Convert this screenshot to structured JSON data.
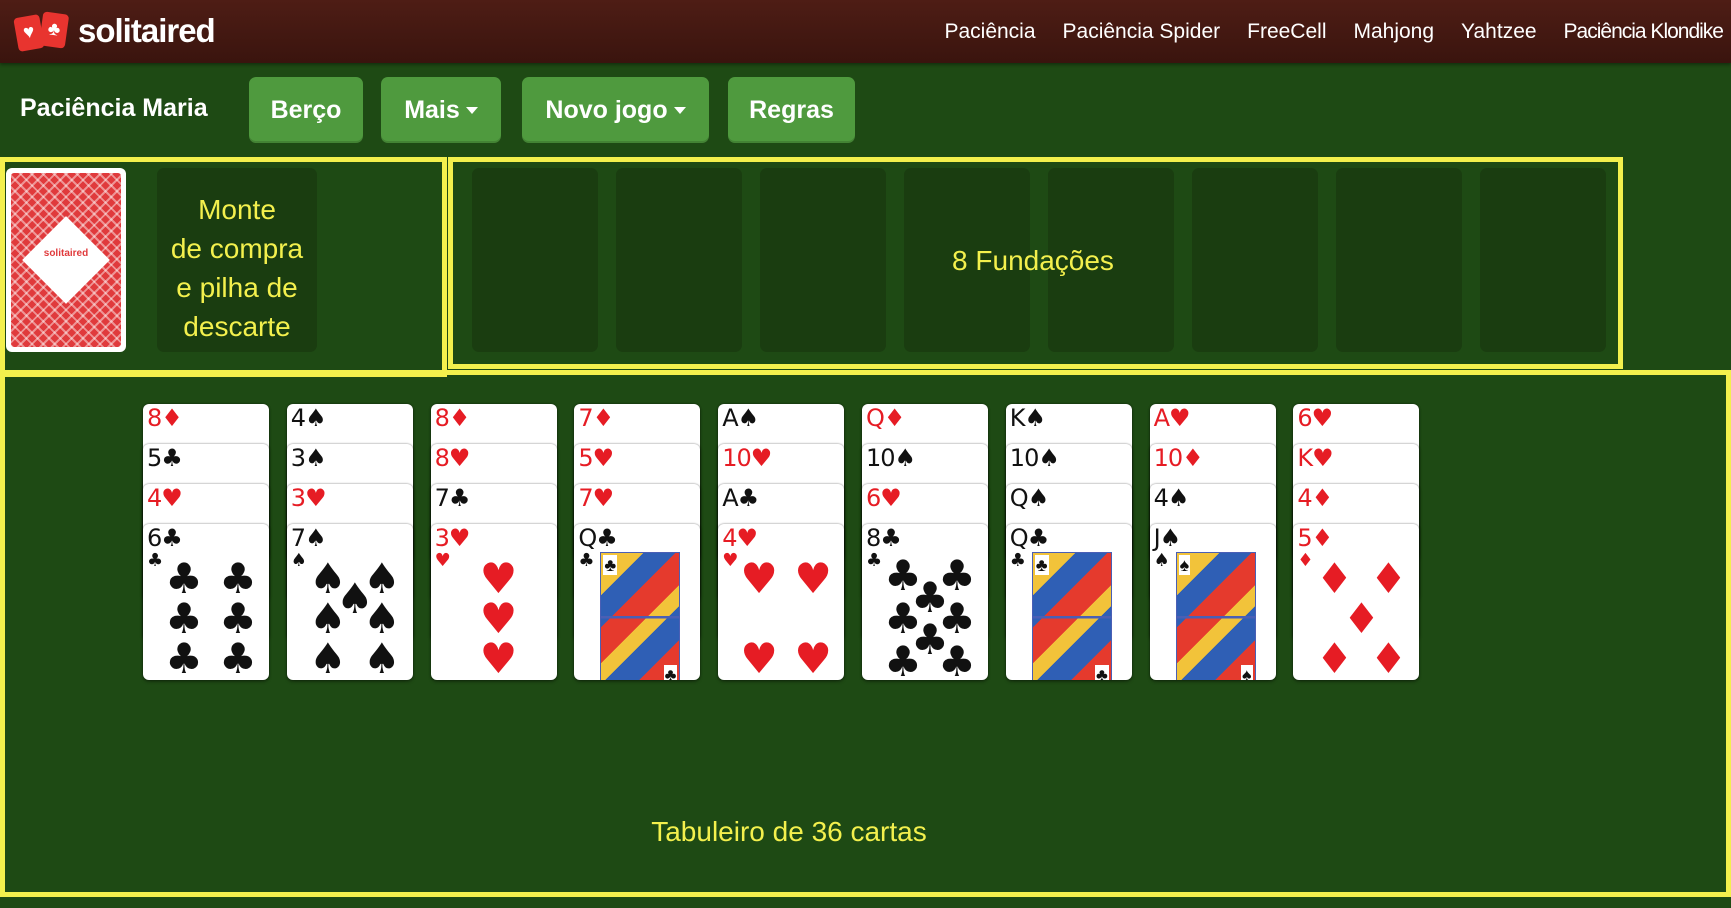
{
  "brand": {
    "name": "solitaired",
    "logo_suits": [
      "♥",
      "♣"
    ]
  },
  "nav": [
    "Paciência",
    "Paciência Spider",
    "FreeCell",
    "Mahjong",
    "Yahtzee",
    "Paciência Klondike"
  ],
  "toolbar": {
    "title": "Paciência Maria",
    "berco": "Berço",
    "mais": "Mais",
    "novo_jogo": "Novo jogo",
    "regras": "Regras"
  },
  "labels": {
    "stock": [
      "Monte",
      "de compra",
      "e pilha de",
      "descarte"
    ],
    "foundations": "8 Fundações",
    "tableau": "Tabuleiro de 36 cartas"
  },
  "stock_card_logo": "solitaired",
  "colors": {
    "felt": "#1e4a14",
    "topbar": "#4e1d15",
    "button": "#4f9a3e",
    "highlight": "#f3f04d",
    "slot": "#1a3d10",
    "red_suit": "#e61c24"
  },
  "game": {
    "foundation_count": 8,
    "tableau": [
      [
        {
          "rank": "8",
          "suit": "♦"
        },
        {
          "rank": "5",
          "suit": "♣"
        },
        {
          "rank": "4",
          "suit": "♥"
        },
        {
          "rank": "6",
          "suit": "♣"
        }
      ],
      [
        {
          "rank": "4",
          "suit": "♠"
        },
        {
          "rank": "3",
          "suit": "♠"
        },
        {
          "rank": "3",
          "suit": "♥"
        },
        {
          "rank": "7",
          "suit": "♠"
        }
      ],
      [
        {
          "rank": "8",
          "suit": "♦"
        },
        {
          "rank": "8",
          "suit": "♥"
        },
        {
          "rank": "7",
          "suit": "♣"
        },
        {
          "rank": "3",
          "suit": "♥"
        }
      ],
      [
        {
          "rank": "7",
          "suit": "♦"
        },
        {
          "rank": "5",
          "suit": "♥"
        },
        {
          "rank": "7",
          "suit": "♥"
        },
        {
          "rank": "Q",
          "suit": "♣"
        }
      ],
      [
        {
          "rank": "A",
          "suit": "♠"
        },
        {
          "rank": "10",
          "suit": "♥"
        },
        {
          "rank": "A",
          "suit": "♣"
        },
        {
          "rank": "4",
          "suit": "♥"
        }
      ],
      [
        {
          "rank": "Q",
          "suit": "♦"
        },
        {
          "rank": "10",
          "suit": "♠"
        },
        {
          "rank": "6",
          "suit": "♥"
        },
        {
          "rank": "8",
          "suit": "♣"
        }
      ],
      [
        {
          "rank": "K",
          "suit": "♠"
        },
        {
          "rank": "10",
          "suit": "♠"
        },
        {
          "rank": "Q",
          "suit": "♠"
        },
        {
          "rank": "Q",
          "suit": "♣"
        }
      ],
      [
        {
          "rank": "A",
          "suit": "♥"
        },
        {
          "rank": "10",
          "suit": "♦"
        },
        {
          "rank": "4",
          "suit": "♠"
        },
        {
          "rank": "J",
          "suit": "♠"
        }
      ],
      [
        {
          "rank": "6",
          "suit": "♥"
        },
        {
          "rank": "K",
          "suit": "♥"
        },
        {
          "rank": "4",
          "suit": "♦"
        },
        {
          "rank": "5",
          "suit": "♦"
        }
      ]
    ]
  }
}
